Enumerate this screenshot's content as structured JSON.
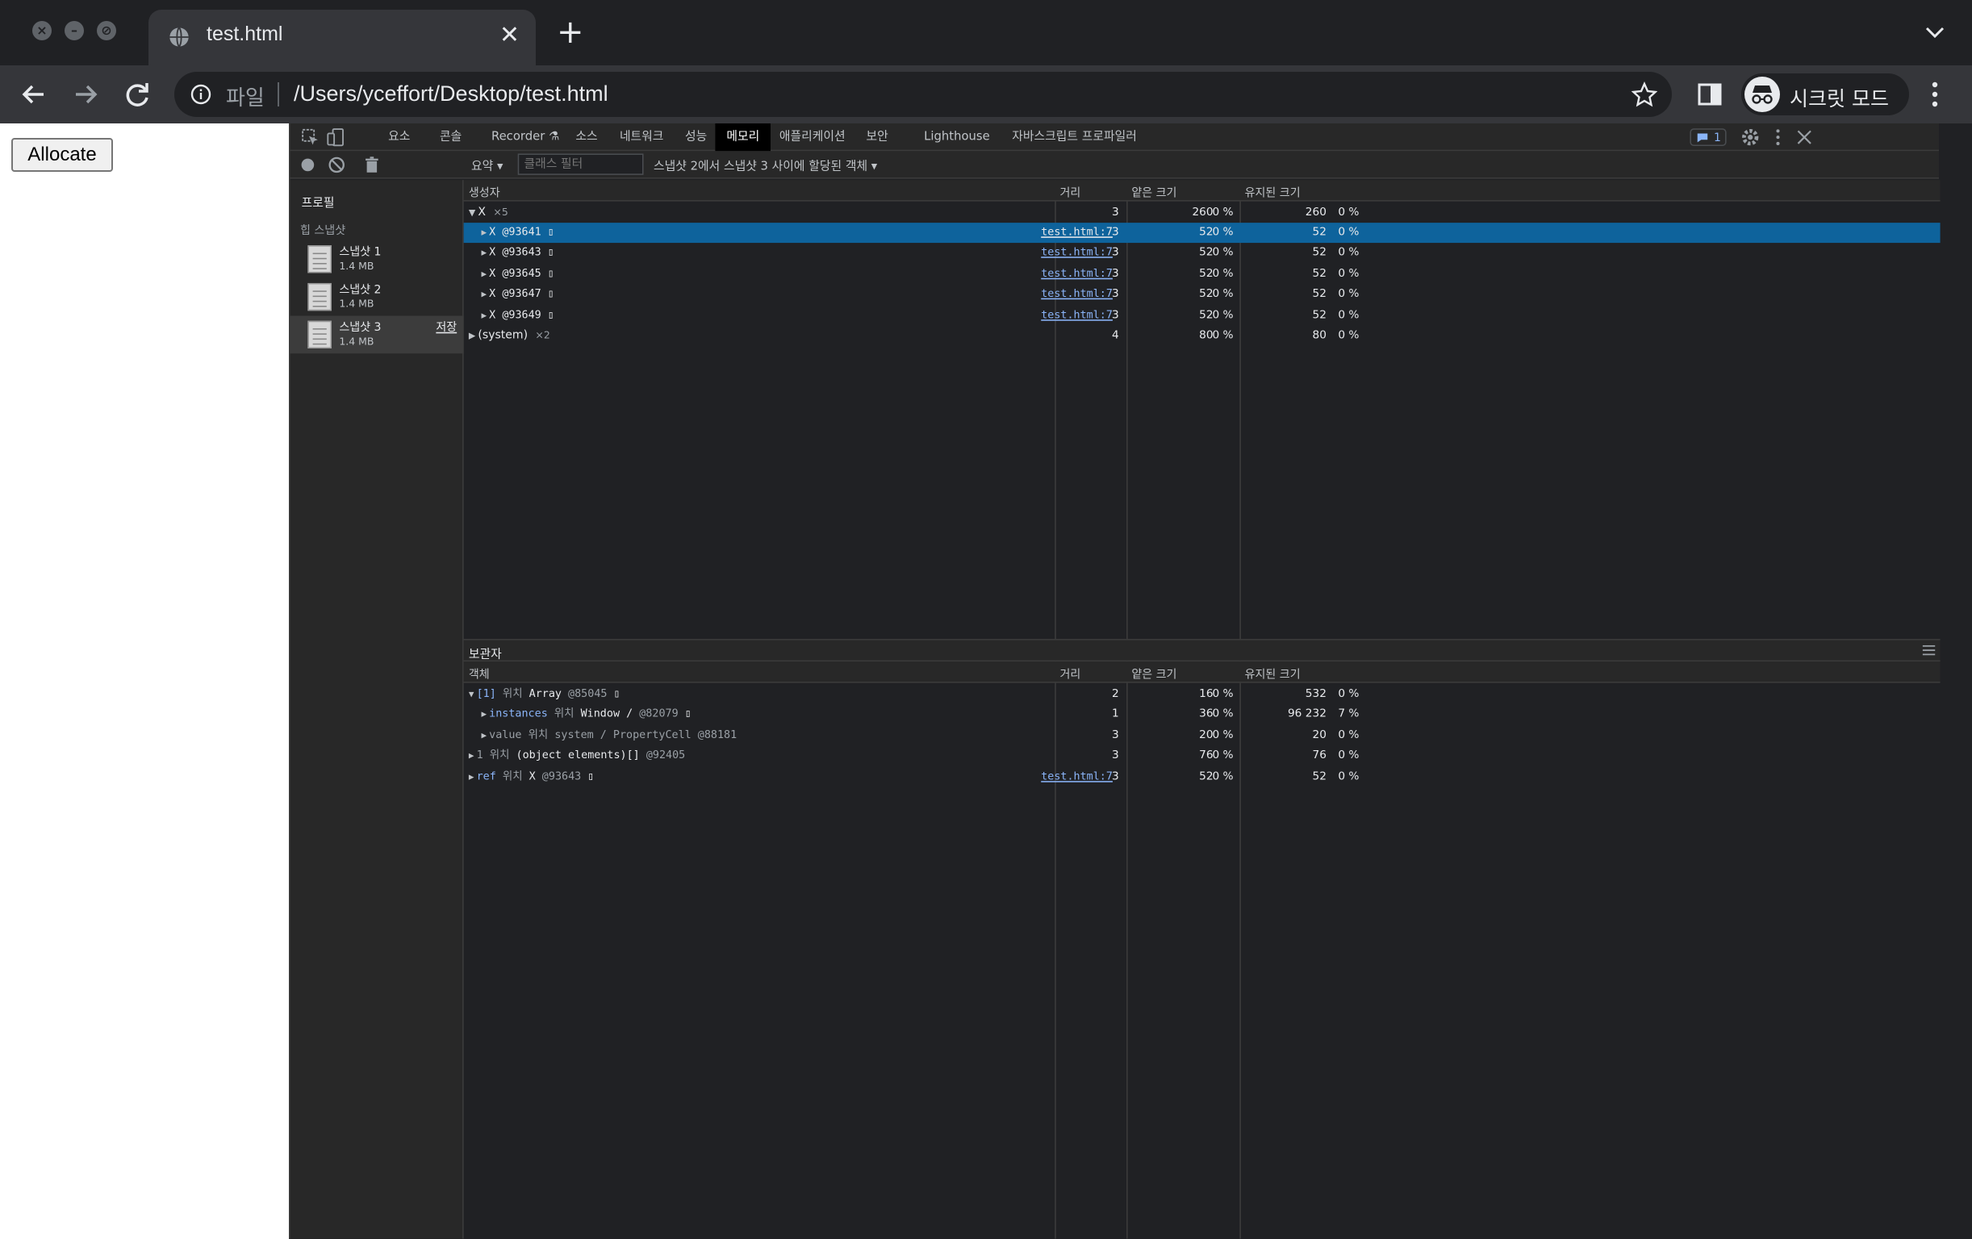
{
  "browser": {
    "tab_title": "test.html",
    "scheme_label": "파일",
    "url": "/Users/yceffort/Desktop/test.html",
    "profile_label": "시크릿 모드",
    "icons": [
      "globe-icon",
      "close-icon",
      "plus-icon",
      "chevron-down-icon",
      "back-arrow-icon",
      "forward-arrow-icon",
      "reload-icon",
      "info-icon",
      "star-icon",
      "side-panel-icon",
      "incognito-icon",
      "more-vert-icon"
    ]
  },
  "page": {
    "allocate_label": "Allocate"
  },
  "devtools": {
    "tabs": [
      "요소",
      "콘솔",
      "Recorder",
      "소스",
      "네트워크",
      "성능",
      "메모리",
      "애플리케이션",
      "보안",
      "Lighthouse",
      "자바스크립트 프로파일러"
    ],
    "active_tab": "메모리",
    "issues_count": "1",
    "toolbar": {
      "summary": "요약",
      "class_filter_placeholder": "클래스 필터",
      "range": "스냅샷 2에서 스냅샷 3 사이에 할당된 객체"
    },
    "sidebar": {
      "profile_heading": "프로필",
      "heap_heading": "힙 스냅샷",
      "snapshots": [
        {
          "name": "스냅샷 1",
          "size": "1.4 MB"
        },
        {
          "name": "스냅샷 2",
          "size": "1.4 MB"
        },
        {
          "name": "스냅샷 3",
          "size": "1.4 MB",
          "save": "저장"
        }
      ]
    },
    "constructors": {
      "headers": {
        "name": "생성자",
        "distance": "거리",
        "shallow": "얕은 크기",
        "retained": "유지된 크기"
      },
      "group": {
        "name": "X",
        "count": "×5",
        "distance": "3",
        "shallow": "260",
        "shallow_pct": "0 %",
        "retained": "260",
        "retained_pct": "0 %"
      },
      "rows": [
        {
          "name": "X",
          "id": "@93641",
          "link": "test.html:7",
          "distance": "3",
          "shallow": "52",
          "shallow_pct": "0 %",
          "retained": "52",
          "retained_pct": "0 %"
        },
        {
          "name": "X",
          "id": "@93643",
          "link": "test.html:7",
          "distance": "3",
          "shallow": "52",
          "shallow_pct": "0 %",
          "retained": "52",
          "retained_pct": "0 %"
        },
        {
          "name": "X",
          "id": "@93645",
          "link": "test.html:7",
          "distance": "3",
          "shallow": "52",
          "shallow_pct": "0 %",
          "retained": "52",
          "retained_pct": "0 %"
        },
        {
          "name": "X",
          "id": "@93647",
          "link": "test.html:7",
          "distance": "3",
          "shallow": "52",
          "shallow_pct": "0 %",
          "retained": "52",
          "retained_pct": "0 %"
        },
        {
          "name": "X",
          "id": "@93649",
          "link": "test.html:7",
          "distance": "3",
          "shallow": "52",
          "shallow_pct": "0 %",
          "retained": "52",
          "retained_pct": "0 %"
        }
      ],
      "system": {
        "name": "(system)",
        "count": "×2",
        "distance": "4",
        "shallow": "80",
        "shallow_pct": "0 %",
        "retained": "80",
        "retained_pct": "0 %"
      }
    },
    "retainers": {
      "title": "보관자",
      "headers": {
        "name": "객체",
        "distance": "거리",
        "shallow": "얕은 크기",
        "retained": "유지된 크기"
      },
      "rows": [
        {
          "key": "[1]",
          "at": "위치",
          "obj": "Array",
          "id": "@85045",
          "distance": "2",
          "shallow": "16",
          "shallow_pct": "0 %",
          "retained": "532",
          "retained_pct": "0 %"
        },
        {
          "key": "instances",
          "at": "위치",
          "obj": "Window /",
          "id": "@82079",
          "distance": "1",
          "shallow": "36",
          "shallow_pct": "0 %",
          "retained": "96 232",
          "retained_pct": "7 %"
        },
        {
          "key": "value",
          "at": "위치",
          "obj": "system / PropertyCell",
          "id": "@88181",
          "distance": "3",
          "shallow": "20",
          "shallow_pct": "0 %",
          "retained": "20",
          "retained_pct": "0 %"
        },
        {
          "key": "1",
          "at": "위치",
          "obj": "(object elements)[]",
          "id": "@92405",
          "distance": "3",
          "shallow": "76",
          "shallow_pct": "0 %",
          "retained": "76",
          "retained_pct": "0 %"
        },
        {
          "key": "ref",
          "at": "위치",
          "obj": "X",
          "id": "@93643",
          "link": "test.html:7",
          "distance": "3",
          "shallow": "52",
          "shallow_pct": "0 %",
          "retained": "52",
          "retained_pct": "0 %"
        }
      ]
    }
  }
}
